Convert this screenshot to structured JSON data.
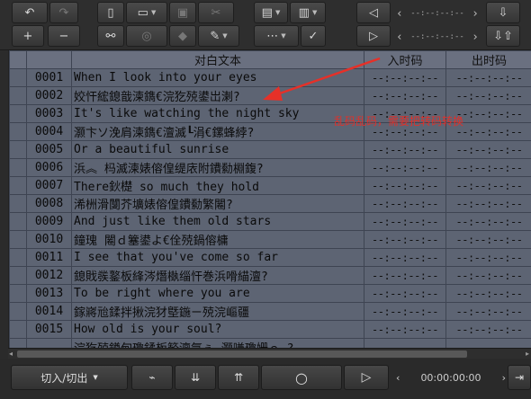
{
  "toolbar": {
    "timecode_placeholder_1": "--:--:--:--",
    "timecode_placeholder_2": "--:--:--:--"
  },
  "table": {
    "headers": {
      "sequence": "",
      "text": "对白文本",
      "in": "入时码",
      "out": "出时码"
    },
    "rows": [
      {
        "num": "0001",
        "text": "When I look into your eyes",
        "in": "--:--:--:--",
        "out": "--:--:--:--"
      },
      {
        "num": "0002",
        "text": "姣忓綋鎴戠湅鐫€浣犵殑鍙岀溂?",
        "in": "--:--:--:--",
        "out": "--:--:--:--"
      },
      {
        "num": "0003",
        "text": "It's like watching the night sky",
        "in": "--:--:--:--",
        "out": "--:--:--:--"
      },
      {
        "num": "0004",
        "text": "灏卞ソ浼肩湅鐫€澶滅┖涓€鏍蜂綍?",
        "in": "--:--:--:--",
        "out": "--:--:--:--"
      },
      {
        "num": "0005",
        "text": "Or a beautiful sunrise",
        "in": "--:--:--:--",
        "out": "--:--:--:--"
      },
      {
        "num": "0006",
        "text": "浜︽  杩滅湅婊傛偟缇庡附鐨勬棩鍑?",
        "in": "--:--:--:--",
        "out": "--:--:--:--"
      },
      {
        "num": "0007",
        "text": "There鈥檚 so much they hold",
        "in": "--:--:--:--",
        "out": "--:--:--:--"
      },
      {
        "num": "0008",
        "text": "浠栦滑闅芥壙婊傛偟鐨勬繁闂?",
        "in": "--:--:--:--",
        "out": "--:--:--:--"
      },
      {
        "num": "0009",
        "text": "And just like them old stars",
        "in": "--:--:--:--",
        "out": "--:--:--:--"
      },
      {
        "num": "0010",
        "text": "鐘瑰  闂ｄ簺鍙よ€佺殑鍋傛槦",
        "in": "--:--:--:--",
        "out": "--:--:--:--"
      },
      {
        "num": "0011",
        "text": "I see that you've come so far",
        "in": "--:--:--:--",
        "out": "--:--:--:--"
      },
      {
        "num": "0012",
        "text": "鎴戝彂鐜板綘涔熸槸缁忓巻浜嗗緢澶?",
        "in": "--:--:--:--",
        "out": "--:--:--:--"
      },
      {
        "num": "0013",
        "text": "To be right where you are",
        "in": "--:--:--:--",
        "out": "--:--:--:--"
      },
      {
        "num": "0014",
        "text": "鎵嶈兘鍒拌揪浣犲墍鍦ㄧ殑浣嶇疆",
        "in": "--:--:--:--",
        "out": "--:--:--:--"
      },
      {
        "num": "0015",
        "text": "How old is your soul?",
        "in": "--:--:--:--",
        "out": "--:--:--:--"
      },
      {
        "num": "",
        "text": "浣犵殑鐏甸瓊鍒板簳澶氬ぇ    灏嗛瓊姗ｅ  ?",
        "in": "",
        "out": ""
      }
    ]
  },
  "annotation": {
    "text": "乱码乱码，需要把转码转换"
  },
  "bottombar": {
    "inout_label": "切入/切出",
    "time": "00:00:00:00"
  }
}
